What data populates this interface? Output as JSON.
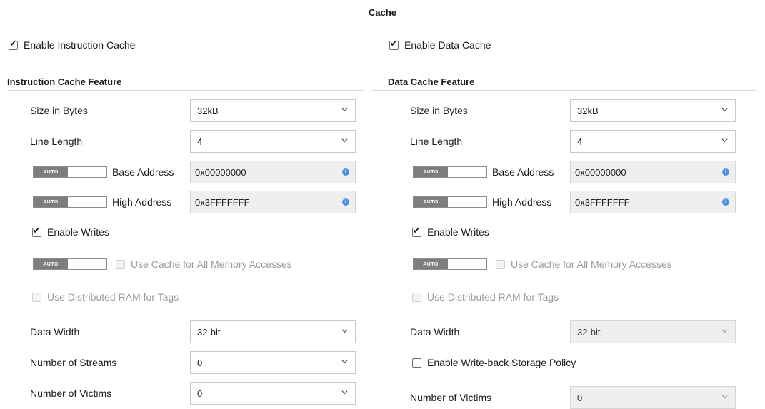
{
  "page": {
    "title": "Cache"
  },
  "instruction": {
    "enable_label": "Enable Instruction Cache",
    "enabled": true,
    "section_title": "Instruction Cache Feature",
    "size_label": "Size in Bytes",
    "size_value": "32kB",
    "line_length_label": "Line Length",
    "line_length_value": "4",
    "auto_label": "AUTO",
    "base_address_label": "Base Address",
    "base_address_value": "0x00000000",
    "high_address_label": "High Address",
    "high_address_value": "0x3FFFFFFF",
    "enable_writes_label": "Enable Writes",
    "enable_writes_checked": true,
    "use_cache_all_label": "Use Cache for All Memory Accesses",
    "use_distributed_ram_label": "Use Distributed RAM for Tags",
    "data_width_label": "Data Width",
    "data_width_value": "32-bit",
    "streams_label": "Number of Streams",
    "streams_value": "0",
    "victims_label": "Number of Victims",
    "victims_value": "0"
  },
  "data": {
    "enable_label": "Enable Data Cache",
    "enabled": true,
    "section_title": "Data Cache Feature",
    "size_label": "Size in Bytes",
    "size_value": "32kB",
    "line_length_label": "Line Length",
    "line_length_value": "4",
    "auto_label": "AUTO",
    "base_address_label": "Base Address",
    "base_address_value": "0x00000000",
    "high_address_label": "High Address",
    "high_address_value": "0x3FFFFFFF",
    "enable_writes_label": "Enable Writes",
    "enable_writes_checked": true,
    "use_cache_all_label": "Use Cache for All Memory Accesses",
    "use_distributed_ram_label": "Use Distributed RAM for Tags",
    "data_width_label": "Data Width",
    "data_width_value": "32-bit",
    "write_back_label": "Enable Write-back Storage Policy",
    "write_back_checked": false,
    "victims_label": "Number of Victims",
    "victims_value": "0"
  },
  "icons": {
    "check": "checkmark-icon",
    "dropdown": "chevron-down-icon",
    "info": "info-icon"
  },
  "colors": {
    "info": "#4a90e2",
    "toggle_knob": "#7d7d7d",
    "disabled_field": "#efefef"
  }
}
